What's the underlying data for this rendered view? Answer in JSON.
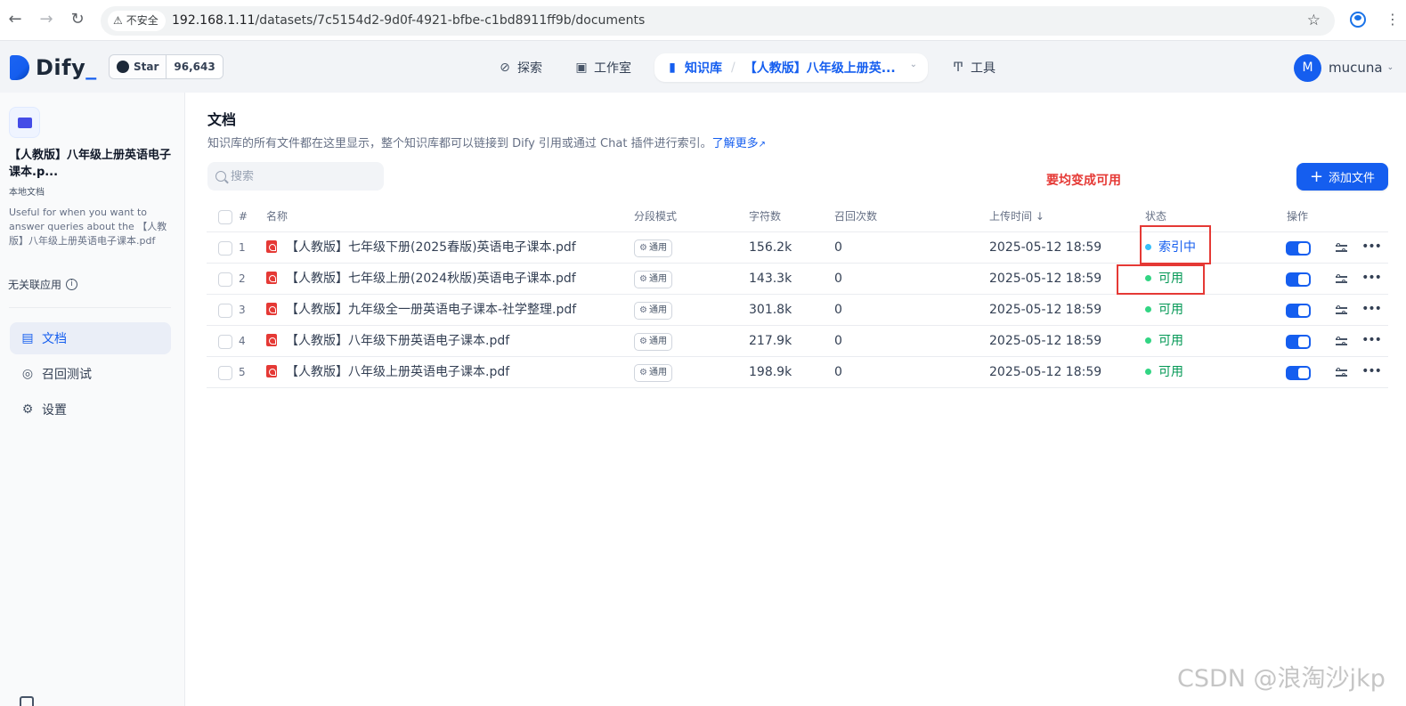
{
  "browser": {
    "insecure_label": "不安全",
    "url_host": "192.168.1.11",
    "url_path": "/datasets/7c5154d2-9d0f-4921-bfbe-c1bd8911ff9b/documents"
  },
  "header": {
    "logo_text": "Dify",
    "github_star_label": "Star",
    "github_star_count": "96,643",
    "nav": {
      "explore": "探索",
      "studio": "工作室",
      "knowledge": "知识库",
      "knowledge_current": "【人教版】八年级上册英...",
      "tools": "工具"
    },
    "user": {
      "initial": "M",
      "name": "mucuna"
    }
  },
  "sidebar": {
    "dataset_name": "【人教版】八年级上册英语电子课本.p...",
    "dataset_type": "本地文档",
    "dataset_description": "Useful for when you want to answer queries about the 【人教版】八年级上册英语电子课本.pdf",
    "no_linked_apps": "无关联应用",
    "menu": {
      "documents": "文档",
      "retrieval_test": "召回测试",
      "settings": "设置"
    }
  },
  "main": {
    "title": "文档",
    "description": "知识库的所有文件都在这里显示，整个知识库都可以链接到 Dify 引用或通过 Chat 插件进行索引。",
    "learn_more": "了解更多",
    "search_placeholder": "搜索",
    "annotation": "要均变成可用",
    "add_file_label": "添加文件",
    "columns": {
      "no": "#",
      "name": "名称",
      "mode": "分段模式",
      "chars": "字符数",
      "recall": "召回次数",
      "upload_time": "上传时间 ↓",
      "status": "状态",
      "actions": "操作"
    },
    "mode_badge": "通用",
    "rows": [
      {
        "no": "1",
        "name": "【人教版】七年级下册(2025春版)英语电子课本.pdf",
        "chars": "156.2k",
        "recall": "0",
        "time": "2025-05-12 18:59",
        "status": "索引中"
      },
      {
        "no": "2",
        "name": "【人教版】七年级上册(2024秋版)英语电子课本.pdf",
        "chars": "143.3k",
        "recall": "0",
        "time": "2025-05-12 18:59",
        "status": "可用"
      },
      {
        "no": "3",
        "name": "【人教版】九年级全一册英语电子课本-社学整理.pdf",
        "chars": "301.8k",
        "recall": "0",
        "time": "2025-05-12 18:59",
        "status": "可用"
      },
      {
        "no": "4",
        "name": "【人教版】八年级下册英语电子课本.pdf",
        "chars": "217.9k",
        "recall": "0",
        "time": "2025-05-12 18:59",
        "status": "可用"
      },
      {
        "no": "5",
        "name": "【人教版】八年级上册英语电子课本.pdf",
        "chars": "198.9k",
        "recall": "0",
        "time": "2025-05-12 18:59",
        "status": "可用"
      }
    ]
  },
  "watermark": "CSDN @浪淘沙jkp",
  "colors": {
    "accent": "#155eef",
    "status_ok": "#039855",
    "annotation": "#e53935"
  }
}
